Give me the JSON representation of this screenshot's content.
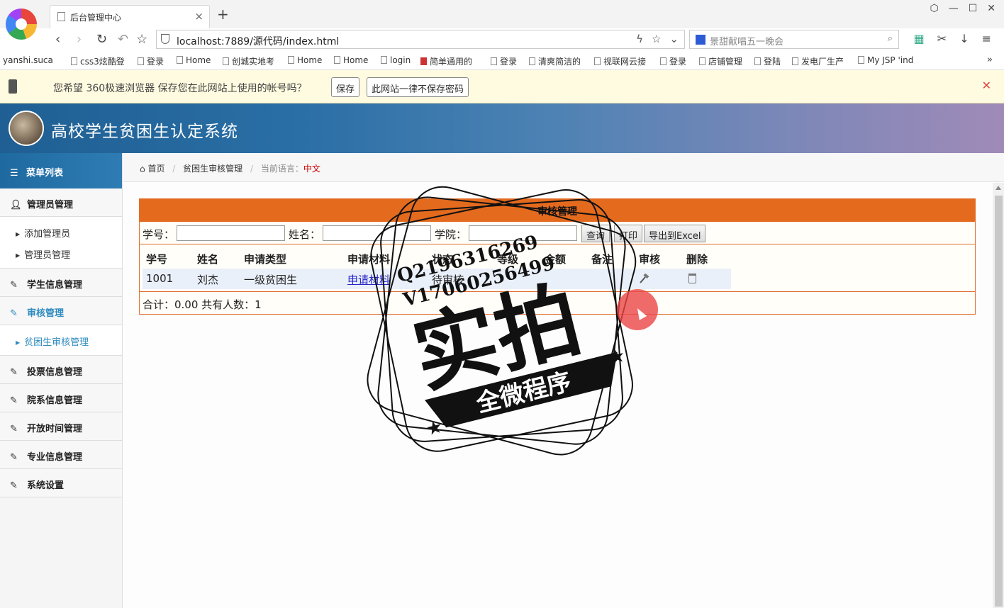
{
  "browser": {
    "tab_title": "后台管理中心",
    "address": "localhost:7889/源代码/index.html",
    "search_placeholder": "景甜献唱五一晚会",
    "bookmarks": [
      "yanshi.suca",
      "css3炫酷登",
      "登录",
      "Home",
      "创城实地考",
      "Home",
      "Home",
      "login",
      "简单通用的",
      "登录",
      "清爽简洁的",
      "视联网云接",
      "登录",
      "店铺管理",
      "登陆",
      "发电厂生产",
      "My JSP 'ind"
    ],
    "password_prompt": "您希望 360极速浏览器 保存您在此网站上使用的帐号吗？",
    "save_label": "保存",
    "never_save_label": "此网站一律不保存密码"
  },
  "app": {
    "title": "高校学生贫困生认定系统"
  },
  "sidebar": {
    "menu_title": "菜单列表",
    "groups": [
      {
        "label": "管理员管理",
        "subs": [
          "添加管理员",
          "管理员管理"
        ]
      },
      {
        "label": "学生信息管理"
      },
      {
        "label": "审核管理",
        "subs": [
          "贫困生审核管理"
        ]
      },
      {
        "label": "投票信息管理"
      },
      {
        "label": "院系信息管理"
      },
      {
        "label": "开放时间管理"
      },
      {
        "label": "专业信息管理"
      },
      {
        "label": "系统设置"
      }
    ]
  },
  "breadcrumb": {
    "home": "首页",
    "current": "贫困生审核管理",
    "lang_label": "当前语言：",
    "lang_value": "中文"
  },
  "panel": {
    "title": "审核管理",
    "filters": {
      "id_label": "学号：",
      "name_label": "姓名：",
      "college_label": "学院：",
      "query": "查询",
      "print": "打印",
      "export": "导出到Excel"
    },
    "columns": [
      "学号",
      "姓名",
      "申请类型",
      "申请材料",
      "状态",
      "等级",
      "金额",
      "备注",
      "审核",
      "删除"
    ],
    "rows": [
      {
        "id": "1001",
        "name": "刘杰",
        "type": "一级贫困生",
        "material": "申请材料",
        "status": "待审核",
        "level": "",
        "amount": "",
        "note": ""
      }
    ],
    "summary": "合计：0.00 共有人数：1"
  },
  "watermark": {
    "line1": "Q2196316269",
    "line2": "V17060256499",
    "main": "实拍",
    "banner": "全微程序"
  }
}
